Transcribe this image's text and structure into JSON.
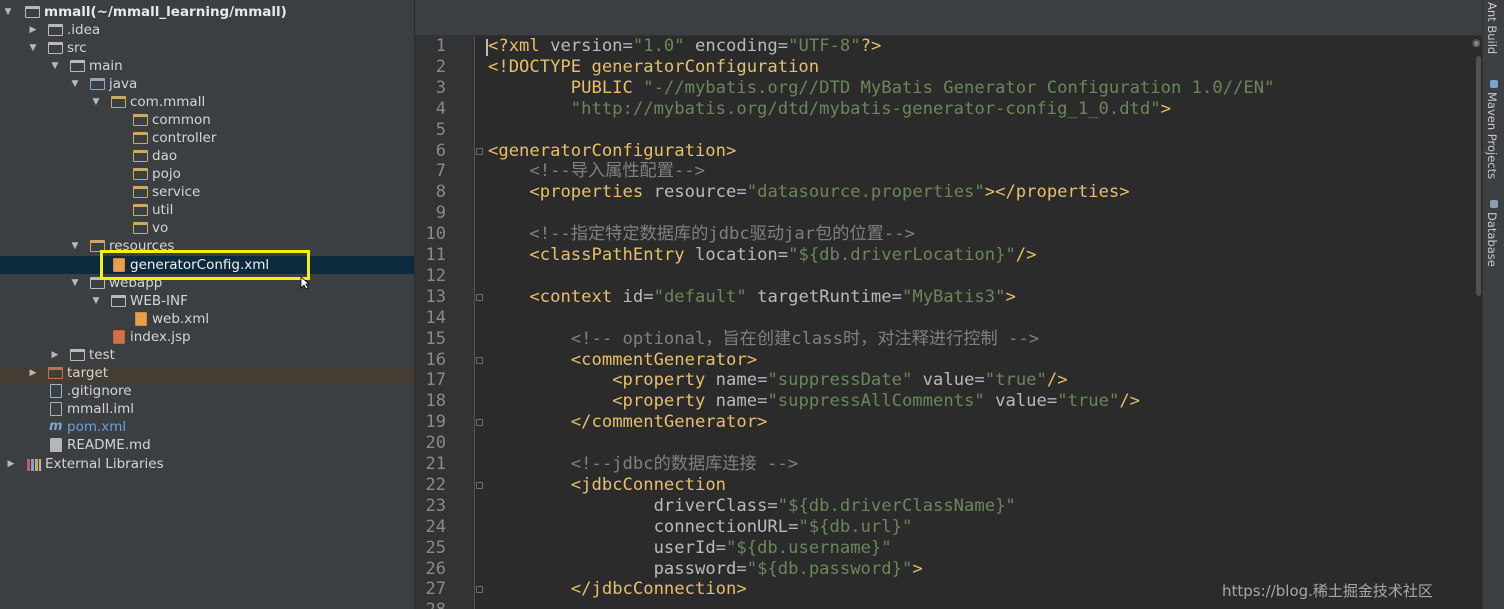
{
  "project_tree": {
    "root": {
      "name": "mmall",
      "path": "(~/mmall_learning/mmall)"
    },
    "items": [
      {
        "label": ".idea"
      },
      {
        "label": "src"
      },
      {
        "label": "main"
      },
      {
        "label": "java"
      },
      {
        "label": "com.mmall"
      },
      {
        "label": "common"
      },
      {
        "label": "controller"
      },
      {
        "label": "dao"
      },
      {
        "label": "pojo"
      },
      {
        "label": "service"
      },
      {
        "label": "util"
      },
      {
        "label": "vo"
      },
      {
        "label": "resources"
      },
      {
        "label": "generatorConfig.xml"
      },
      {
        "label": "webapp"
      },
      {
        "label": "WEB-INF"
      },
      {
        "label": "web.xml"
      },
      {
        "label": "index.jsp"
      },
      {
        "label": "test"
      },
      {
        "label": "target"
      },
      {
        "label": ".gitignore"
      },
      {
        "label": "mmall.iml"
      },
      {
        "label": "pom.xml"
      },
      {
        "label": "README.md"
      },
      {
        "label": "External Libraries"
      }
    ]
  },
  "editor": {
    "line_numbers": [
      "1",
      "2",
      "3",
      "4",
      "5",
      "6",
      "7",
      "8",
      "9",
      "10",
      "11",
      "12",
      "13",
      "14",
      "15",
      "16",
      "17",
      "18",
      "19",
      "20",
      "21",
      "22",
      "23",
      "24",
      "25",
      "26",
      "27",
      "28"
    ],
    "lines": [
      {
        "parts": [
          [
            "t",
            "<?xml "
          ],
          [
            "a",
            "version"
          ],
          [
            "p",
            "="
          ],
          [
            "v",
            "\"1.0\""
          ],
          [
            "p",
            " "
          ],
          [
            "a",
            "encoding"
          ],
          [
            "p",
            "="
          ],
          [
            "v",
            "\"UTF-8\""
          ],
          [
            "t",
            "?>"
          ]
        ]
      },
      {
        "parts": [
          [
            "t",
            "<!DOCTYPE generatorConfiguration"
          ]
        ]
      },
      {
        "parts": [
          [
            "t",
            "        PUBLIC "
          ],
          [
            "v",
            "\"-//mybatis.org//DTD MyBatis Generator Configuration 1.0//EN\""
          ]
        ]
      },
      {
        "parts": [
          [
            "v",
            "        \"http://mybatis.org/dtd/mybatis-generator-config_1_0.dtd\""
          ],
          [
            "t",
            ">"
          ]
        ]
      },
      {
        "parts": []
      },
      {
        "parts": [
          [
            "t",
            "<generatorConfiguration>"
          ]
        ]
      },
      {
        "parts": [
          [
            "c",
            "    <!--导入属性配置-->"
          ]
        ]
      },
      {
        "parts": [
          [
            "p",
            "    "
          ],
          [
            "t",
            "<properties "
          ],
          [
            "a",
            "resource"
          ],
          [
            "p",
            "="
          ],
          [
            "v",
            "\"datasource.properties\""
          ],
          [
            "t",
            "></properties>"
          ]
        ]
      },
      {
        "parts": []
      },
      {
        "parts": [
          [
            "c",
            "    <!--指定特定数据库的jdbc驱动jar包的位置-->"
          ]
        ]
      },
      {
        "parts": [
          [
            "p",
            "    "
          ],
          [
            "t",
            "<classPathEntry "
          ],
          [
            "a",
            "location"
          ],
          [
            "p",
            "="
          ],
          [
            "v",
            "\"${db.driverLocation}\""
          ],
          [
            "t",
            "/>"
          ]
        ]
      },
      {
        "parts": []
      },
      {
        "parts": [
          [
            "p",
            "    "
          ],
          [
            "t",
            "<context "
          ],
          [
            "a",
            "id"
          ],
          [
            "p",
            "="
          ],
          [
            "v",
            "\"default\""
          ],
          [
            "p",
            " "
          ],
          [
            "a",
            "targetRuntime"
          ],
          [
            "p",
            "="
          ],
          [
            "v",
            "\"MyBatis3\""
          ],
          [
            "t",
            ">"
          ]
        ]
      },
      {
        "parts": []
      },
      {
        "parts": [
          [
            "c",
            "        <!-- optional，旨在创建class时，对注释进行控制 -->"
          ]
        ]
      },
      {
        "parts": [
          [
            "p",
            "        "
          ],
          [
            "t",
            "<commentGenerator>"
          ]
        ]
      },
      {
        "parts": [
          [
            "p",
            "            "
          ],
          [
            "t",
            "<property "
          ],
          [
            "a",
            "name"
          ],
          [
            "p",
            "="
          ],
          [
            "v",
            "\"suppressDate\""
          ],
          [
            "p",
            " "
          ],
          [
            "a",
            "value"
          ],
          [
            "p",
            "="
          ],
          [
            "v",
            "\"true\""
          ],
          [
            "t",
            "/>"
          ]
        ]
      },
      {
        "parts": [
          [
            "p",
            "            "
          ],
          [
            "t",
            "<property "
          ],
          [
            "a",
            "name"
          ],
          [
            "p",
            "="
          ],
          [
            "v",
            "\"suppressAllComments\""
          ],
          [
            "p",
            " "
          ],
          [
            "a",
            "value"
          ],
          [
            "p",
            "="
          ],
          [
            "v",
            "\"true\""
          ],
          [
            "t",
            "/>"
          ]
        ]
      },
      {
        "parts": [
          [
            "p",
            "        "
          ],
          [
            "t",
            "</commentGenerator>"
          ]
        ]
      },
      {
        "parts": []
      },
      {
        "parts": [
          [
            "c",
            "        <!--jdbc的数据库连接 -->"
          ]
        ]
      },
      {
        "parts": [
          [
            "p",
            "        "
          ],
          [
            "t",
            "<jdbcConnection"
          ]
        ]
      },
      {
        "parts": [
          [
            "p",
            "                "
          ],
          [
            "a",
            "driverClass"
          ],
          [
            "p",
            "="
          ],
          [
            "v",
            "\"${db.driverClassName}\""
          ]
        ]
      },
      {
        "parts": [
          [
            "p",
            "                "
          ],
          [
            "a",
            "connectionURL"
          ],
          [
            "p",
            "="
          ],
          [
            "v",
            "\"${db.url}\""
          ]
        ]
      },
      {
        "parts": [
          [
            "p",
            "                "
          ],
          [
            "a",
            "userId"
          ],
          [
            "p",
            "="
          ],
          [
            "v",
            "\"${db.username}\""
          ]
        ]
      },
      {
        "parts": [
          [
            "p",
            "                "
          ],
          [
            "a",
            "password"
          ],
          [
            "p",
            "="
          ],
          [
            "v",
            "\"${db.password}\""
          ],
          [
            "t",
            ">"
          ]
        ]
      },
      {
        "parts": [
          [
            "p",
            "        "
          ],
          [
            "t",
            "</jdbcConnection>"
          ]
        ]
      },
      {
        "parts": []
      }
    ]
  },
  "right_toolbar": {
    "tabs": [
      {
        "label": "Ant Build"
      },
      {
        "label": "Maven Projects"
      },
      {
        "label": "Database"
      }
    ]
  },
  "watermark": "https://blog.稀土掘金技术社区"
}
